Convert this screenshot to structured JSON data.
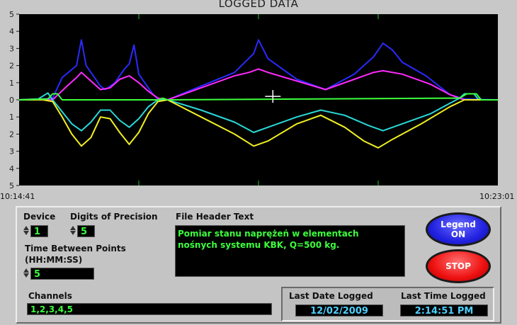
{
  "chart_data": {
    "type": "line",
    "title": "LOGGED DATA",
    "x_start_label": "10:14:41",
    "x_end_label": "10:23:01",
    "y_ticks": [
      "5",
      "4",
      "3",
      "2",
      "1",
      "0",
      "1",
      "2",
      "3",
      "4",
      "5"
    ],
    "ylim": [
      -5,
      5
    ],
    "grid": false,
    "crosshair": {
      "x": 0.53,
      "y": 0.2
    },
    "series": [
      {
        "color": "#2a2aff",
        "points": [
          [
            0,
            0
          ],
          [
            0.05,
            0.05
          ],
          [
            0.07,
            0.1
          ],
          [
            0.09,
            1.3
          ],
          [
            0.12,
            2.0
          ],
          [
            0.13,
            3.5
          ],
          [
            0.14,
            2.0
          ],
          [
            0.17,
            0.8
          ],
          [
            0.18,
            0.6
          ],
          [
            0.2,
            1.0
          ],
          [
            0.22,
            1.8
          ],
          [
            0.23,
            2.1
          ],
          [
            0.24,
            3.2
          ],
          [
            0.25,
            1.5
          ],
          [
            0.27,
            0.7
          ],
          [
            0.28,
            0.3
          ],
          [
            0.29,
            0.05
          ],
          [
            0.31,
            0
          ],
          [
            0.38,
            0.8
          ],
          [
            0.45,
            1.6
          ],
          [
            0.49,
            2.7
          ],
          [
            0.5,
            3.5
          ],
          [
            0.52,
            2.4
          ],
          [
            0.58,
            1.2
          ],
          [
            0.64,
            0.6
          ],
          [
            0.7,
            1.5
          ],
          [
            0.74,
            2.5
          ],
          [
            0.76,
            3.3
          ],
          [
            0.78,
            2.9
          ],
          [
            0.8,
            2.2
          ],
          [
            0.85,
            1.4
          ],
          [
            0.9,
            0.3
          ],
          [
            0.93,
            0.05
          ],
          [
            1,
            0
          ]
        ]
      },
      {
        "color": "#ff2aff",
        "points": [
          [
            0,
            0
          ],
          [
            0.05,
            0.05
          ],
          [
            0.07,
            0
          ],
          [
            0.1,
            0.8
          ],
          [
            0.12,
            1.3
          ],
          [
            0.13,
            1.6
          ],
          [
            0.15,
            1.1
          ],
          [
            0.17,
            0.6
          ],
          [
            0.19,
            0.7
          ],
          [
            0.21,
            1.2
          ],
          [
            0.23,
            1.4
          ],
          [
            0.25,
            1.0
          ],
          [
            0.27,
            0.5
          ],
          [
            0.29,
            0.1
          ],
          [
            0.31,
            0
          ],
          [
            0.38,
            0.7
          ],
          [
            0.45,
            1.4
          ],
          [
            0.48,
            1.6
          ],
          [
            0.5,
            1.8
          ],
          [
            0.52,
            1.6
          ],
          [
            0.58,
            1.1
          ],
          [
            0.64,
            0.6
          ],
          [
            0.7,
            1.2
          ],
          [
            0.74,
            1.6
          ],
          [
            0.76,
            1.7
          ],
          [
            0.8,
            1.5
          ],
          [
            0.86,
            0.9
          ],
          [
            0.9,
            0.3
          ],
          [
            0.93,
            0
          ],
          [
            1,
            0
          ]
        ]
      },
      {
        "color": "#2ad8d8",
        "points": [
          [
            0,
            0
          ],
          [
            0.04,
            0.05
          ],
          [
            0.06,
            0.4
          ],
          [
            0.07,
            0
          ],
          [
            0.09,
            -0.7
          ],
          [
            0.11,
            -1.4
          ],
          [
            0.13,
            -1.8
          ],
          [
            0.15,
            -1.3
          ],
          [
            0.17,
            -0.6
          ],
          [
            0.19,
            -0.6
          ],
          [
            0.21,
            -1.2
          ],
          [
            0.23,
            -1.6
          ],
          [
            0.25,
            -1.1
          ],
          [
            0.27,
            -0.4
          ],
          [
            0.29,
            0
          ],
          [
            0.31,
            0
          ],
          [
            0.38,
            -0.6
          ],
          [
            0.45,
            -1.3
          ],
          [
            0.49,
            -1.9
          ],
          [
            0.52,
            -1.6
          ],
          [
            0.58,
            -1.0
          ],
          [
            0.63,
            -0.6
          ],
          [
            0.68,
            -0.9
          ],
          [
            0.73,
            -1.5
          ],
          [
            0.76,
            -1.8
          ],
          [
            0.8,
            -1.4
          ],
          [
            0.86,
            -0.8
          ],
          [
            0.9,
            -0.2
          ],
          [
            0.92,
            0.1
          ],
          [
            0.93,
            0.35
          ],
          [
            0.95,
            0.35
          ],
          [
            0.96,
            0
          ],
          [
            1,
            0
          ]
        ]
      },
      {
        "color": "#f0f020",
        "points": [
          [
            0,
            0
          ],
          [
            0.05,
            0
          ],
          [
            0.07,
            -0.1
          ],
          [
            0.09,
            -1.0
          ],
          [
            0.11,
            -2.0
          ],
          [
            0.13,
            -2.7
          ],
          [
            0.15,
            -2.2
          ],
          [
            0.17,
            -1.0
          ],
          [
            0.19,
            -1.1
          ],
          [
            0.21,
            -1.9
          ],
          [
            0.23,
            -2.6
          ],
          [
            0.25,
            -1.9
          ],
          [
            0.27,
            -0.8
          ],
          [
            0.29,
            -0.1
          ],
          [
            0.31,
            0
          ],
          [
            0.38,
            -1.0
          ],
          [
            0.45,
            -2.0
          ],
          [
            0.49,
            -2.7
          ],
          [
            0.52,
            -2.4
          ],
          [
            0.58,
            -1.4
          ],
          [
            0.63,
            -0.9
          ],
          [
            0.68,
            -1.6
          ],
          [
            0.72,
            -2.4
          ],
          [
            0.75,
            -2.8
          ],
          [
            0.78,
            -2.3
          ],
          [
            0.84,
            -1.4
          ],
          [
            0.9,
            -0.4
          ],
          [
            0.93,
            0
          ],
          [
            1,
            0
          ]
        ]
      },
      {
        "color": "#3cff3c",
        "points": [
          [
            0,
            0
          ],
          [
            0.06,
            0.05
          ],
          [
            0.07,
            0.35
          ],
          [
            0.08,
            0.35
          ],
          [
            0.09,
            0
          ],
          [
            0.29,
            0
          ],
          [
            0.3,
            0.1
          ],
          [
            0.31,
            0
          ],
          [
            0.92,
            0.1
          ],
          [
            0.935,
            0.35
          ],
          [
            0.955,
            0.35
          ],
          [
            0.965,
            0
          ],
          [
            1,
            0
          ]
        ]
      }
    ]
  },
  "panel": {
    "device_label": "Device",
    "device_value": "1",
    "digits_label": "Digits of Precision",
    "digits_value": "5",
    "file_header_label": "File Header Text",
    "file_header_line1": "Pomiar stanu naprężeń w elementach",
    "file_header_line2": "nośnych systemu KBK, Q=500 kg.",
    "time_between_label": "Time Between Points",
    "time_format_label": "(HH:MM:SS)",
    "time_between_value": "5",
    "channels_label": "Channels",
    "channels_value": "1,2,3,4,5",
    "legend_line1": "Legend",
    "legend_line2": "ON",
    "stop_label": "STOP",
    "last_date_label": "Last Date Logged",
    "last_date_value": "12/02/2009",
    "last_time_label": "Last Time Logged",
    "last_time_value": "2:14:51 PM"
  }
}
